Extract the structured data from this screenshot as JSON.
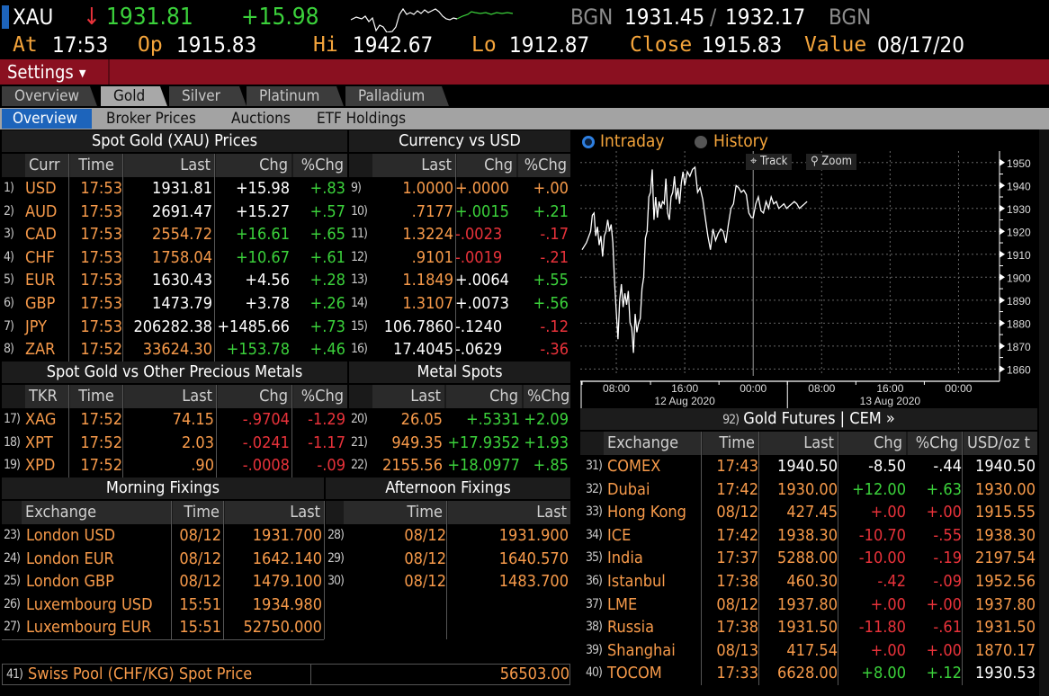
{
  "ticker": {
    "symbol": "XAU",
    "direction_icon": "down-arrow-icon",
    "last": "1931.81",
    "change": "+15.98",
    "bid_source": "BGN",
    "bid": "1931.45",
    "separator": "/",
    "ask": "1932.17",
    "ask_source": "BGN",
    "at_label": "At",
    "at_value": "17:53",
    "open_label": "Op",
    "open_value": "1915.83",
    "high_label": "Hi",
    "high_value": "1942.67",
    "low_label": "Lo",
    "low_value": "1912.87",
    "close_label": "Close",
    "close_value": "1915.83",
    "value_label": "Value",
    "value_date": "08/17/20"
  },
  "settings": {
    "label": "Settings",
    "caret_icon": "caret-down-icon"
  },
  "tabs_primary": [
    {
      "label": "Overview",
      "active": false
    },
    {
      "label": "Gold",
      "active": true
    },
    {
      "label": "Silver",
      "active": false
    },
    {
      "label": "Platinum",
      "active": false
    },
    {
      "label": "Palladium",
      "active": false
    }
  ],
  "tabs_secondary": [
    {
      "label": "Overview",
      "active": true
    },
    {
      "label": "Broker Prices",
      "active": false
    },
    {
      "label": "Auctions",
      "active": false
    },
    {
      "label": "ETF Holdings",
      "active": false
    }
  ],
  "spot_gold": {
    "title": "Spot Gold (XAU) Prices",
    "headers": [
      "Curr",
      "Time",
      "Last",
      "Chg",
      "%Chg"
    ],
    "rows": [
      {
        "n": "1)",
        "curr": "USD",
        "time": "17:53",
        "last": "1931.81",
        "chg": "+15.98",
        "pct": "+.83",
        "last_c": "white",
        "chg_c": "white",
        "pct_c": "green"
      },
      {
        "n": "2)",
        "curr": "AUD",
        "time": "17:53",
        "last": "2691.47",
        "chg": "+15.27",
        "pct": "+.57",
        "last_c": "white",
        "chg_c": "white",
        "pct_c": "green"
      },
      {
        "n": "3)",
        "curr": "CAD",
        "time": "17:53",
        "last": "2554.72",
        "chg": "+16.61",
        "pct": "+.65",
        "last_c": "orange",
        "chg_c": "green",
        "pct_c": "green"
      },
      {
        "n": "4)",
        "curr": "CHF",
        "time": "17:53",
        "last": "1758.04",
        "chg": "+10.67",
        "pct": "+.61",
        "last_c": "orange",
        "chg_c": "green",
        "pct_c": "green"
      },
      {
        "n": "5)",
        "curr": "EUR",
        "time": "17:53",
        "last": "1630.43",
        "chg": "+4.56",
        "pct": "+.28",
        "last_c": "white",
        "chg_c": "white",
        "pct_c": "green"
      },
      {
        "n": "6)",
        "curr": "GBP",
        "time": "17:53",
        "last": "1473.79",
        "chg": "+3.78",
        "pct": "+.26",
        "last_c": "white",
        "chg_c": "white",
        "pct_c": "green"
      },
      {
        "n": "7)",
        "curr": "JPY",
        "time": "17:53",
        "last": "206282.38",
        "chg": "+1485.66",
        "pct": "+.73",
        "last_c": "white",
        "chg_c": "white",
        "pct_c": "green"
      },
      {
        "n": "8)",
        "curr": "ZAR",
        "time": "17:52",
        "last": "33624.30",
        "chg": "+153.78",
        "pct": "+.46",
        "last_c": "orange",
        "chg_c": "green",
        "pct_c": "green"
      }
    ]
  },
  "currency_vs_usd": {
    "title": "Currency vs USD",
    "headers": [
      "Last",
      "Chg",
      "%Chg"
    ],
    "rows": [
      {
        "n": "9)",
        "last": "1.0000",
        "chg": "+.0000",
        "pct": "+.00",
        "last_c": "orange",
        "chg_c": "orange",
        "pct_c": "orange"
      },
      {
        "n": "10)",
        "last": ".7177",
        "chg": "+.0015",
        "pct": "+.21",
        "last_c": "orange",
        "chg_c": "green",
        "pct_c": "green"
      },
      {
        "n": "11)",
        "last": "1.3224",
        "chg": "-.0023",
        "pct": "-.17",
        "last_c": "orange",
        "chg_c": "red",
        "pct_c": "red"
      },
      {
        "n": "12)",
        "last": ".9101",
        "chg": "-.0019",
        "pct": "-.21",
        "last_c": "orange",
        "chg_c": "red",
        "pct_c": "red"
      },
      {
        "n": "13)",
        "last": "1.1849",
        "chg": "+.0064",
        "pct": "+.55",
        "last_c": "orange",
        "chg_c": "white",
        "pct_c": "green"
      },
      {
        "n": "14)",
        "last": "1.3107",
        "chg": "+.0073",
        "pct": "+.56",
        "last_c": "orange",
        "chg_c": "white",
        "pct_c": "green"
      },
      {
        "n": "15)",
        "last": "106.7860",
        "chg": "-.1240",
        "pct": "-.12",
        "last_c": "white",
        "chg_c": "white",
        "pct_c": "red"
      },
      {
        "n": "16)",
        "last": "17.4045",
        "chg": "-.0629",
        "pct": "-.36",
        "last_c": "white",
        "chg_c": "white",
        "pct_c": "red"
      }
    ]
  },
  "vs_precious": {
    "title": "Spot Gold vs Other Precious Metals",
    "headers": [
      "TKR",
      "Time",
      "Last",
      "Chg",
      "%Chg"
    ],
    "rows": [
      {
        "n": "17)",
        "tkr": "XAG",
        "time": "17:52",
        "last": "74.15",
        "chg": "-.9704",
        "pct": "-1.29"
      },
      {
        "n": "18)",
        "tkr": "XPT",
        "time": "17:52",
        "last": "2.03",
        "chg": "-.0241",
        "pct": "-1.17"
      },
      {
        "n": "19)",
        "tkr": "XPD",
        "time": "17:52",
        "last": ".90",
        "chg": "-.0008",
        "pct": "-.09"
      }
    ]
  },
  "metal_spots": {
    "title": "Metal Spots",
    "headers": [
      "Last",
      "Chg",
      "%Chg"
    ],
    "rows": [
      {
        "n": "20)",
        "last": "26.05",
        "chg": "+.5331",
        "pct": "+2.09"
      },
      {
        "n": "21)",
        "last": "949.35",
        "chg": "+17.9352",
        "pct": "+1.93"
      },
      {
        "n": "22)",
        "last": "2155.56",
        "chg": "+18.0977",
        "pct": "+.85"
      }
    ]
  },
  "morning_fixings": {
    "title": "Morning Fixings",
    "headers": [
      "Exchange",
      "Time",
      "Last"
    ],
    "rows": [
      {
        "n": "23)",
        "exch": "London USD",
        "time": "08/12",
        "last": "1931.700"
      },
      {
        "n": "24)",
        "exch": "London EUR",
        "time": "08/12",
        "last": "1642.140"
      },
      {
        "n": "25)",
        "exch": "London GBP",
        "time": "08/12",
        "last": "1479.100"
      },
      {
        "n": "26)",
        "exch": "Luxembourg USD",
        "time": "15:51",
        "last": "1934.980"
      },
      {
        "n": "27)",
        "exch": "Luxembourg EUR",
        "time": "15:51",
        "last": "52750.000"
      }
    ]
  },
  "afternoon_fixings": {
    "title": "Afternoon Fixings",
    "headers": [
      "Time",
      "Last"
    ],
    "rows": [
      {
        "n": "28)",
        "time": "08/12",
        "last": "1931.900"
      },
      {
        "n": "29)",
        "time": "08/12",
        "last": "1640.570"
      },
      {
        "n": "30)",
        "time": "08/12",
        "last": "1483.700"
      }
    ]
  },
  "swiss_pool": {
    "n": "41)",
    "label": "Swiss Pool (CHF/KG) Spot Price",
    "value": "56503.00"
  },
  "chart_controls": {
    "intraday_label": "Intraday",
    "history_label": "History",
    "selected": "Intraday",
    "track_label": "Track",
    "zoom_label": "Zoom"
  },
  "chart_data": {
    "type": "line",
    "title": "",
    "xlabel": "",
    "ylabel": "",
    "ylim": [
      1857,
      1955
    ],
    "yticks": [
      1950,
      1940,
      1930,
      1920,
      1910,
      1900,
      1890,
      1880,
      1870,
      1860
    ],
    "xlim_hours": [
      0,
      48
    ],
    "x_tick_labels": [
      "08:00",
      "16:00",
      "00:00",
      "08:00",
      "16:00",
      "00:00"
    ],
    "x_tick_hours": [
      8,
      16,
      24,
      32,
      40,
      48
    ],
    "date_labels": [
      "12 Aug 2020",
      "13 Aug 2020"
    ],
    "grid": true,
    "series": [
      {
        "name": "XAU",
        "x_hours": [
          4.0,
          4.5,
          5.0,
          5.2,
          5.4,
          5.6,
          5.8,
          6.0,
          6.2,
          6.4,
          6.6,
          6.8,
          7.0,
          7.2,
          7.4,
          7.6,
          7.8,
          8.0,
          8.2,
          8.4,
          8.6,
          8.8,
          9.0,
          9.2,
          9.4,
          9.6,
          9.8,
          10.0,
          10.2,
          10.4,
          10.6,
          10.8,
          11.0,
          11.2,
          11.4,
          11.6,
          11.8,
          12.0,
          12.2,
          12.4,
          12.6,
          12.8,
          13.0,
          13.2,
          13.4,
          13.6,
          13.8,
          14.0,
          14.2,
          14.4,
          14.6,
          14.8,
          15.0,
          15.2,
          15.4,
          15.6,
          15.8,
          16.0,
          16.3,
          16.6,
          16.9,
          17.2,
          17.5,
          17.8,
          18.1,
          18.4,
          18.7,
          19.0,
          19.3,
          19.6,
          19.9,
          20.2,
          20.5,
          20.8,
          21.1,
          21.4,
          21.7,
          22.0,
          22.3,
          22.6,
          22.9,
          23.2,
          23.5,
          23.8,
          24.0,
          24.3,
          24.6,
          24.9,
          25.2,
          25.5,
          25.8,
          26.1,
          26.4,
          26.7,
          27.0,
          27.3,
          27.6,
          27.9,
          28.2,
          28.5,
          28.8,
          29.1,
          29.4,
          29.7,
          30.0,
          30.3,
          30.6,
          30.9,
          31.2,
          31.5,
          31.8,
          32.1,
          32.4,
          32.7,
          33.0,
          33.3,
          33.6,
          33.9,
          34.2,
          34.5,
          34.8,
          35.1,
          35.4,
          35.7,
          36.0,
          36.3,
          36.6,
          36.9,
          37.2,
          37.5,
          37.8,
          38.1,
          38.4,
          38.7,
          39.0,
          39.3,
          39.6,
          39.9,
          40.2,
          40.5,
          40.8,
          41.1,
          41.4,
          41.7,
          42.0
        ],
        "values": [
          1912,
          1915,
          1920,
          1927,
          1928,
          1918,
          1922,
          1914,
          1918,
          1909,
          1918,
          1920,
          1925,
          1920,
          1923,
          1915,
          1898,
          1885,
          1873,
          1890,
          1897,
          1887,
          1893,
          1888,
          1894,
          1880,
          1878,
          1867,
          1884,
          1876,
          1880,
          1882,
          1895,
          1900,
          1917,
          1920,
          1935,
          1937,
          1947,
          1925,
          1935,
          1926,
          1933,
          1930,
          1933,
          1932,
          1943,
          1928,
          1925,
          1935,
          1937,
          1944,
          1934,
          1939,
          1932,
          1941,
          1946,
          1940,
          1946,
          1944,
          1947,
          1948,
          1937,
          1939,
          1934,
          1926,
          1918,
          1912,
          1921,
          1916,
          1919,
          1921,
          1920,
          1915,
          1923,
          1930,
          1932,
          1940,
          1939,
          1937,
          1938,
          1936,
          1928,
          1926,
          1926,
          1932,
          1935,
          1929,
          1928,
          1933,
          1930,
          1935,
          1932,
          1933,
          1930,
          1931,
          1932,
          1930,
          1931,
          1932,
          1933,
          1932,
          1930,
          1931,
          1932,
          1933
        ],
        "color": "#ffffff"
      }
    ],
    "legend": "none"
  },
  "gold_futures": {
    "title_prefix": "92)",
    "title": "Gold Futures | CEM »",
    "headers": [
      "Exchange",
      "Time",
      "Last",
      "Chg",
      "%Chg",
      "USD/oz t"
    ],
    "rows": [
      {
        "n": "31)",
        "exch": "COMEX",
        "time": "17:43",
        "last": "1940.50",
        "chg": "-8.50",
        "pct": "-.44",
        "usd": "1940.50",
        "last_c": "white",
        "chg_c": "white",
        "pct_c": "white",
        "usd_c": "white"
      },
      {
        "n": "32)",
        "exch": "Dubai",
        "time": "17:42",
        "last": "1930.00",
        "chg": "+12.00",
        "pct": "+.63",
        "usd": "1930.00",
        "last_c": "orange",
        "chg_c": "green",
        "pct_c": "green",
        "usd_c": "orange"
      },
      {
        "n": "33)",
        "exch": "Hong Kong",
        "time": "08/12",
        "last": "427.45",
        "chg": "+.00",
        "pct": "+.00",
        "usd": "1915.55",
        "last_c": "orange",
        "chg_c": "red",
        "pct_c": "red",
        "usd_c": "orange"
      },
      {
        "n": "34)",
        "exch": "ICE",
        "time": "17:42",
        "last": "1938.30",
        "chg": "-10.70",
        "pct": "-.55",
        "usd": "1938.30",
        "last_c": "orange",
        "chg_c": "red",
        "pct_c": "red",
        "usd_c": "orange"
      },
      {
        "n": "35)",
        "exch": "India",
        "time": "17:37",
        "last": "5288.00",
        "chg": "-10.00",
        "pct": "-.19",
        "usd": "2197.54",
        "last_c": "orange",
        "chg_c": "red",
        "pct_c": "red",
        "usd_c": "orange"
      },
      {
        "n": "36)",
        "exch": "Istanbul",
        "time": "17:38",
        "last": "460.30",
        "chg": "-.42",
        "pct": "-.09",
        "usd": "1952.56",
        "last_c": "orange",
        "chg_c": "red",
        "pct_c": "red",
        "usd_c": "orange"
      },
      {
        "n": "37)",
        "exch": "LME",
        "time": "08/12",
        "last": "1937.80",
        "chg": "+.00",
        "pct": "+.00",
        "usd": "1937.80",
        "last_c": "orange",
        "chg_c": "red",
        "pct_c": "red",
        "usd_c": "orange"
      },
      {
        "n": "38)",
        "exch": "Russia",
        "time": "17:38",
        "last": "1931.50",
        "chg": "-11.80",
        "pct": "-.61",
        "usd": "1931.50",
        "last_c": "orange",
        "chg_c": "red",
        "pct_c": "red",
        "usd_c": "orange"
      },
      {
        "n": "39)",
        "exch": "Shanghai",
        "time": "08/13",
        "last": "417.54",
        "chg": "+.00",
        "pct": "+.00",
        "usd": "1870.17",
        "last_c": "orange",
        "chg_c": "red",
        "pct_c": "red",
        "usd_c": "orange"
      },
      {
        "n": "40)",
        "exch": "TOCOM",
        "time": "17:33",
        "last": "6628.00",
        "chg": "+8.00",
        "pct": "+.12",
        "usd": "1930.53",
        "last_c": "orange",
        "chg_c": "green",
        "pct_c": "green",
        "usd_c": "white"
      }
    ]
  },
  "colors": {
    "amber": "#f4a43b",
    "orange": "#f79a4a",
    "green": "#3bd13b",
    "red": "#e8323a",
    "settings_bar": "#8a1020",
    "active_tab": "#1d64bb"
  }
}
